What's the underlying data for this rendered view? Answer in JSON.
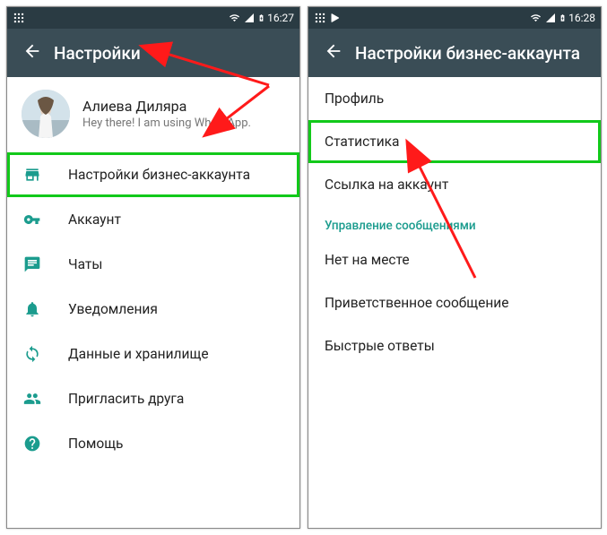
{
  "colors": {
    "header": "#3a4d56",
    "statusbar": "#2a3b43",
    "accent": "#1b9c8e",
    "highlight": "#12c91a",
    "arrow": "#ff1a1a"
  },
  "left": {
    "statusbar": {
      "time": "16:27"
    },
    "appbar": {
      "title": "Настройки"
    },
    "profile": {
      "name": "Алиева Диляра",
      "status": "Hey there! I am using WhatsApp."
    },
    "items": [
      {
        "label": "Настройки бизнес-аккаунта",
        "icon": "storefront-icon"
      },
      {
        "label": "Аккаунт",
        "icon": "key-icon"
      },
      {
        "label": "Чаты",
        "icon": "chat-icon"
      },
      {
        "label": "Уведомления",
        "icon": "bell-icon"
      },
      {
        "label": "Данные и хранилище",
        "icon": "sync-icon"
      },
      {
        "label": "Пригласить друга",
        "icon": "group-icon"
      },
      {
        "label": "Помощь",
        "icon": "help-icon"
      }
    ]
  },
  "right": {
    "statusbar": {
      "time": "16:28"
    },
    "appbar": {
      "title": "Настройки бизнес-аккаунта"
    },
    "items": [
      {
        "label": "Профиль"
      },
      {
        "label": "Статистика"
      },
      {
        "label": "Ссылка на аккаунт"
      }
    ],
    "sectionHeader": "Управление сообщениями",
    "items2": [
      {
        "label": "Нет на месте"
      },
      {
        "label": "Приветственное сообщение"
      },
      {
        "label": "Быстрые ответы"
      }
    ]
  }
}
